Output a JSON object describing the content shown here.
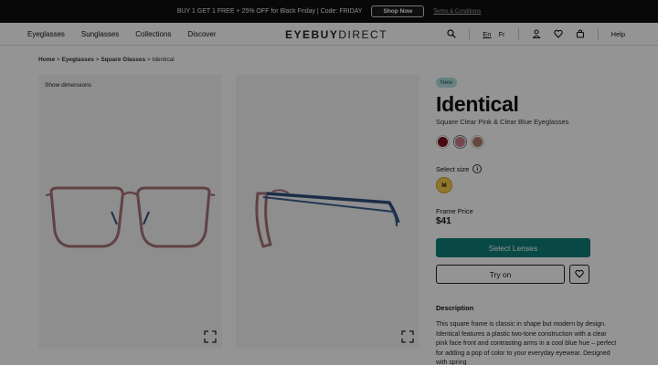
{
  "promo": {
    "text": "BUY 1 GET 1 FREE + 25% OFF for Black Friday | Code: FRIDAY",
    "shop_now": "Shop Now",
    "terms": "Terms & Conditions"
  },
  "nav": {
    "links": [
      "Eyeglasses",
      "Sunglasses",
      "Collections",
      "Discover"
    ],
    "logo_bold": "EYEBUY",
    "logo_light": "DIRECT",
    "lang_en": "En",
    "lang_fr": "Fr",
    "help": "Help",
    "icons": [
      "search-icon",
      "user-icon",
      "heart-icon",
      "cart-icon"
    ]
  },
  "breadcrumb": {
    "home": "Home",
    "eyeglasses": "Eyeglasses",
    "category": "Square Glasses",
    "current": "Identical",
    "sep": " > "
  },
  "gallery": {
    "show_dimensions": "Show dimensions"
  },
  "product": {
    "badge": "New",
    "name": "Identical",
    "subtitle": "Square Clear Pink & Clear Blue Eyeglasses",
    "swatch_colors": [
      "#7a1220",
      "#c97a86",
      "#b27b6a"
    ],
    "size_label": "Select size",
    "size": "M",
    "price_label": "Frame Price",
    "price": "$41",
    "select_lenses": "Select Lenses",
    "try_on": "Try on",
    "description_heading": "Description",
    "description": "This square frame is classic in shape but modern by design. Identical features a plastic two-tone construction with a clear pink face front and contrasting arms in a cool blue hue – perfect for adding a pop of color to your everyday eyewear. Designed with spring"
  },
  "colors": {
    "accent": "#0f7f78",
    "size_chip": "#f7ce4b",
    "badge": "#b4e1e0"
  }
}
